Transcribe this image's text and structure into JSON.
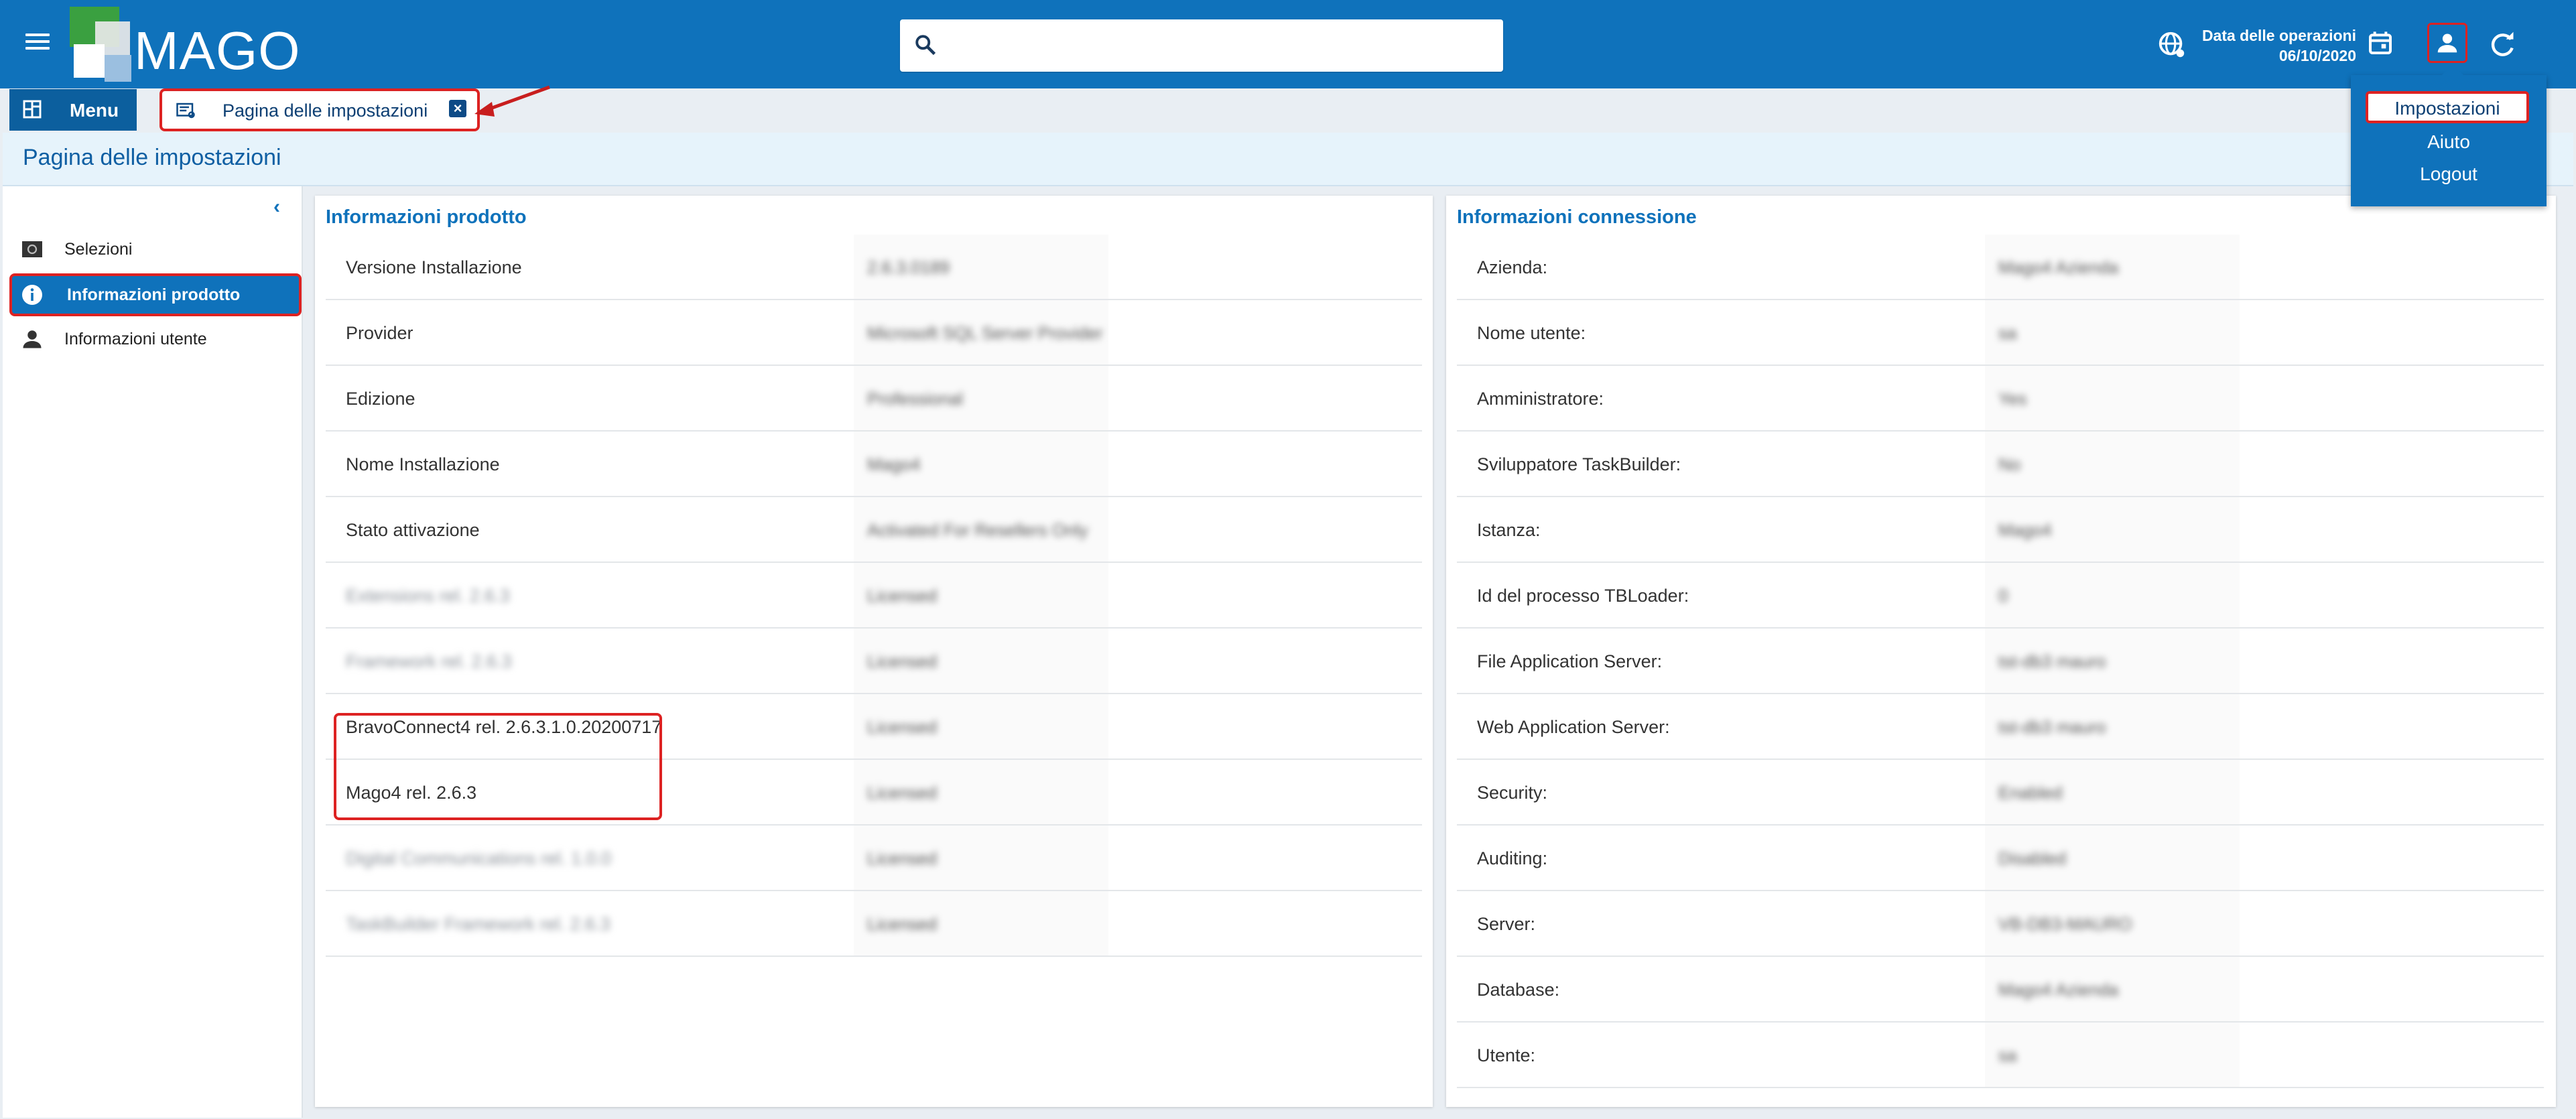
{
  "header": {
    "logo_text": "MAGO",
    "search_placeholder": "",
    "op_date_label": "Data delle operazioni",
    "op_date_value": "06/10/2020"
  },
  "tabs": {
    "menu_label": "Menu",
    "active_tab_label": "Pagina delle impostazioni"
  },
  "page": {
    "title": "Pagina delle impostazioni"
  },
  "sidebar": {
    "collapse_glyph": "‹",
    "items": [
      {
        "label": "Selezioni",
        "icon": "selection-icon"
      },
      {
        "label": "Informazioni prodotto",
        "icon": "info-icon",
        "active": true
      },
      {
        "label": "Informazioni utente",
        "icon": "person-icon"
      }
    ]
  },
  "user_menu": {
    "items": [
      "Impostazioni",
      "Aiuto",
      "Logout"
    ]
  },
  "product_info": {
    "title": "Informazioni prodotto",
    "rows": [
      {
        "key": "Versione Installazione",
        "value": "2.6.3.0189"
      },
      {
        "key": "Provider",
        "value": "Microsoft SQL Server Provider"
      },
      {
        "key": "Edizione",
        "value": "Professional"
      },
      {
        "key": "Nome Installazione",
        "value": "Mago4"
      },
      {
        "key": "Stato attivazione",
        "value": "Activated For Resellers Only"
      },
      {
        "key": "Extensions rel. 2.6.3",
        "value": "Licensed"
      },
      {
        "key": "Framework rel. 2.6.3",
        "value": "Licensed"
      },
      {
        "key": "BravoConnect4 rel. 2.6.3.1.0.20200717",
        "value": "Licensed"
      },
      {
        "key": "Mago4 rel. 2.6.3",
        "value": "Licensed"
      },
      {
        "key": "Digital Communications rel. 1.0.0",
        "value": "Licensed"
      },
      {
        "key": "TaskBuilder Framework rel. 2.6.3",
        "value": "Licensed"
      }
    ]
  },
  "connection_info": {
    "title": "Informazioni connessione",
    "rows": [
      {
        "key": "Azienda:",
        "value": "Mago4 Azienda"
      },
      {
        "key": "Nome utente:",
        "value": "sa"
      },
      {
        "key": "Amministratore:",
        "value": "Yes"
      },
      {
        "key": "Sviluppatore TaskBuilder:",
        "value": "No"
      },
      {
        "key": "Istanza:",
        "value": "Mago4"
      },
      {
        "key": "Id del processo TBLoader:",
        "value": "0"
      },
      {
        "key": "File Application Server:",
        "value": "tst-db3 mauro"
      },
      {
        "key": "Web Application Server:",
        "value": "tst-db3 mauro"
      },
      {
        "key": "Security:",
        "value": "Enabled"
      },
      {
        "key": "Auditing:",
        "value": "Disabled"
      },
      {
        "key": "Server:",
        "value": "VB-DB3-MAURO"
      },
      {
        "key": "Database:",
        "value": "Mago4 Azienda"
      },
      {
        "key": "Utente:",
        "value": "sa"
      }
    ]
  }
}
